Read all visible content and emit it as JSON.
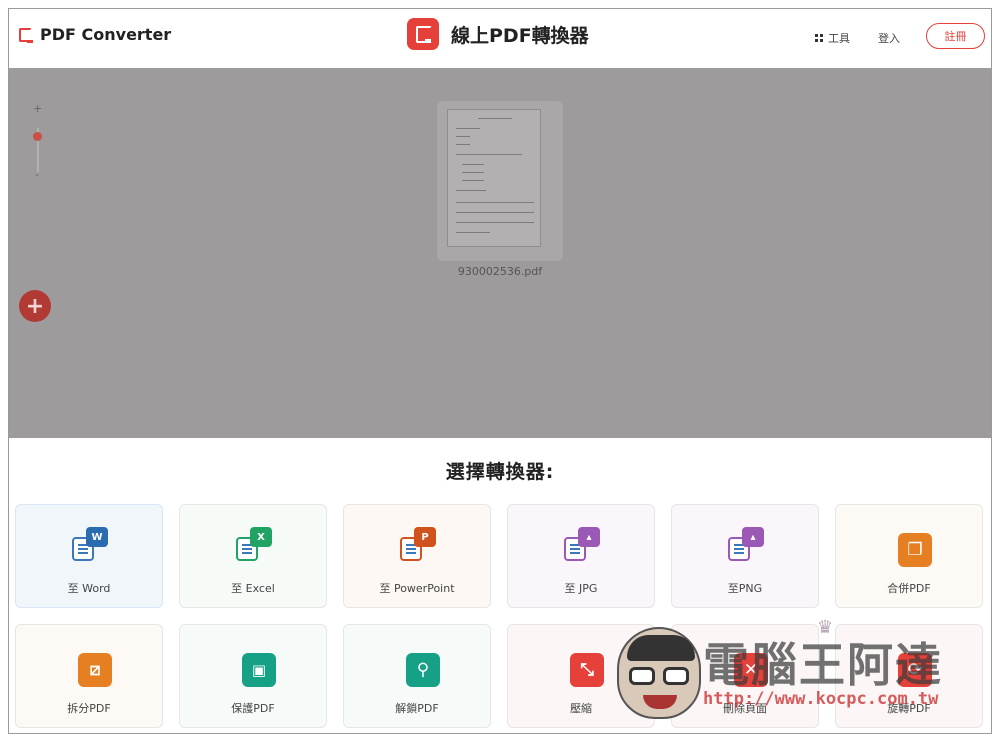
{
  "header": {
    "logo_text": "PDF Converter",
    "center_title": "線上PDF轉換器",
    "tools_label": "工具",
    "login_label": "登入",
    "signup_label": "註冊"
  },
  "workspace": {
    "zoom_in": "+",
    "zoom_out": "-",
    "add_symbol": "+",
    "file_name": "930002536.pdf"
  },
  "converter": {
    "title": "選擇轉換器:",
    "tiles": [
      {
        "label": "至 Word",
        "badge": "W",
        "color": "#2b6cb0"
      },
      {
        "label": "至 Excel",
        "badge": "X",
        "color": "#21a366"
      },
      {
        "label": "至 PowerPoint",
        "badge": "P",
        "color": "#d0521c"
      },
      {
        "label": "至 JPG",
        "badge": "▲",
        "color": "#9b59b6"
      },
      {
        "label": "至PNG",
        "badge": "▲",
        "color": "#9b59b6"
      },
      {
        "label": "合併PDF",
        "badge": "❐",
        "color": "#e67e22"
      },
      {
        "label": "拆分PDF",
        "badge": "◪",
        "color": "#e67e22"
      },
      {
        "label": "保護PDF",
        "badge": "🔒",
        "color": "#16a085"
      },
      {
        "label": "解鎖PDF",
        "badge": "⚲",
        "color": "#16a085"
      },
      {
        "label": "壓縮",
        "badge": "⤡",
        "color": "#e5403a"
      },
      {
        "label": "刪除頁面",
        "badge": "✕",
        "color": "#e5403a"
      },
      {
        "label": "旋轉PDF",
        "badge": "⟳",
        "color": "#e5403a"
      }
    ]
  },
  "watermark": {
    "title": "電腦王阿達",
    "url": "http://www.kocpc.com.tw"
  }
}
